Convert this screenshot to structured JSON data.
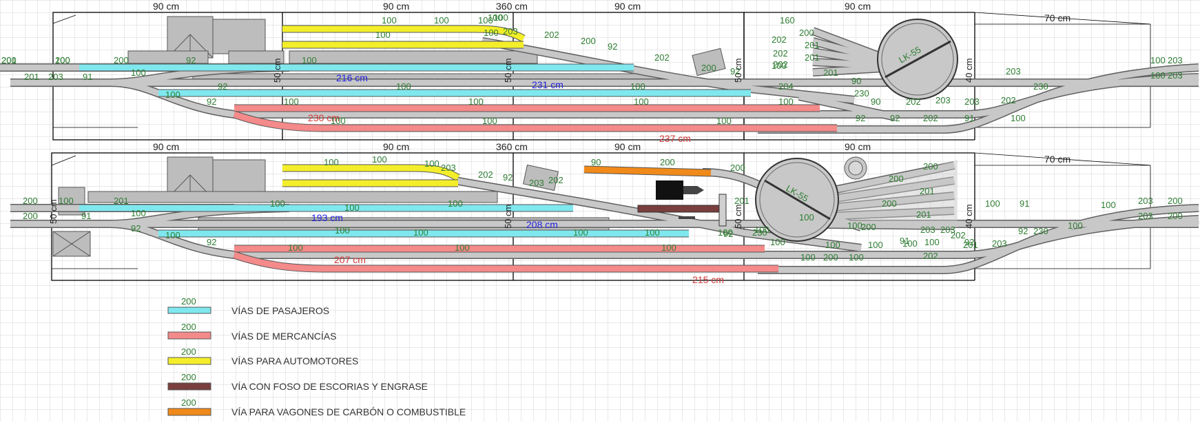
{
  "colors": {
    "grid": "#d3d3d3",
    "track": "#c8c8c8",
    "track_edge": "#606060",
    "passenger": "#7fe8ee",
    "freight": "#f48a8a",
    "railcar": "#f4ee2a",
    "slag": "#7a3e3e",
    "coal": "#f08a1a",
    "building": "#bdbdbd",
    "label_green": "#2e7d32",
    "label_blue": "#2222dd",
    "label_red": "#d33a3a"
  },
  "layout_top": {
    "dims": [
      "90 cm",
      "90 cm",
      "360 cm",
      "90 cm",
      "90 cm",
      "70 cm"
    ],
    "side_dims": [
      "50 cm",
      "50 cm",
      "50 cm",
      "40 cm"
    ],
    "lengths_blue": [
      "216 cm",
      "231 cm"
    ],
    "lengths_red": [
      "230 cm",
      "237 cm"
    ],
    "turntable": "LK-55",
    "piece_labels": [
      "201",
      "100",
      "200",
      "203",
      "91",
      "201",
      "92",
      "100",
      "100",
      "92",
      "100",
      "92",
      "100",
      "100",
      "100",
      "100",
      "100",
      "100",
      "100",
      "100",
      "100",
      "100",
      "100",
      "100",
      "100",
      "100",
      "100",
      "100",
      "100",
      "203",
      "202",
      "200",
      "92",
      "202",
      "200",
      "92",
      "160",
      "200",
      "202",
      "201",
      "202",
      "201",
      "202",
      "201",
      "204",
      "90",
      "230",
      "90",
      "202",
      "203",
      "92",
      "92",
      "202",
      "203",
      "91",
      "202",
      "203",
      "230",
      "100",
      "100",
      "100",
      "203",
      "203",
      "200",
      "200"
    ]
  },
  "layout_bottom": {
    "dims": [
      "90 cm",
      "90 cm",
      "360 cm",
      "90 cm",
      "90 cm",
      "70 cm"
    ],
    "side_dims": [
      "50 cm",
      "50 cm",
      "50 cm",
      "40 cm"
    ],
    "lengths_blue": [
      "193 cm",
      "208 cm"
    ],
    "lengths_red": [
      "207 cm",
      "215 cm"
    ],
    "turntable": "LK-55",
    "piece_labels": [
      "200",
      "100",
      "200",
      "91",
      "201",
      "92",
      "100",
      "100",
      "92",
      "100",
      "100",
      "100",
      "100",
      "100",
      "100",
      "100",
      "100",
      "100",
      "100",
      "100",
      "100",
      "100",
      "100",
      "100",
      "100",
      "100",
      "203",
      "202",
      "92",
      "203",
      "202",
      "90",
      "200",
      "200",
      "201",
      "230",
      "100",
      "100",
      "100",
      "100",
      "100",
      "203",
      "202",
      "92",
      "203",
      "92",
      "91",
      "202",
      "203",
      "201",
      "200",
      "200",
      "201",
      "200",
      "201",
      "200",
      "100",
      "91",
      "230",
      "100",
      "100",
      "203",
      "203",
      "200",
      "200",
      "92",
      "100",
      "200",
      "100"
    ]
  },
  "legend": [
    {
      "swatch_label": "200",
      "text": "VÍAS DE PASAJEROS",
      "color_key": "passenger"
    },
    {
      "swatch_label": "200",
      "text": "VÍAS DE MERCANCÍAS",
      "color_key": "freight"
    },
    {
      "swatch_label": "200",
      "text": "VÍAS PARA AUTOMOTORES",
      "color_key": "railcar"
    },
    {
      "swatch_label": "200",
      "text": "VÍA CON FOSO DE ESCORIAS Y ENGRASE",
      "color_key": "slag"
    },
    {
      "swatch_label": "200",
      "text": "VÍA PARA VAGONES DE CARBÓN O COMBUSTIBLE",
      "color_key": "coal"
    }
  ]
}
